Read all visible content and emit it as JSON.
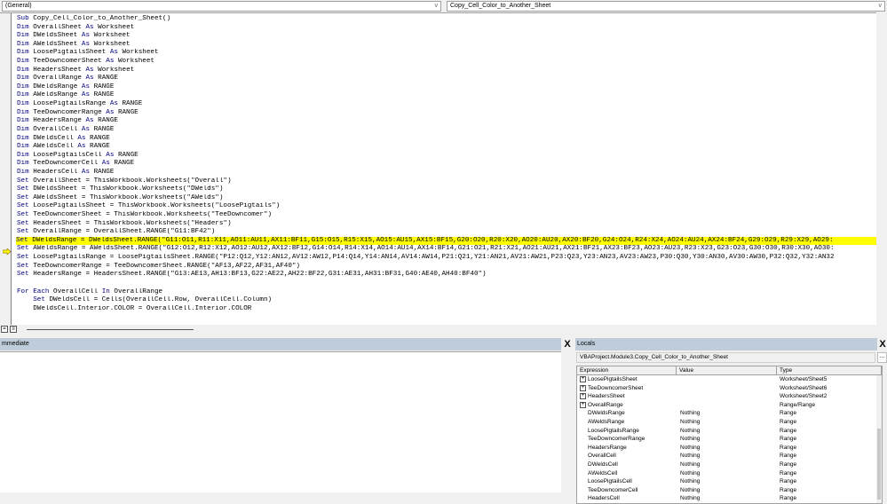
{
  "object_combo": "(General)",
  "procedure_combo": "Copy_Cell_Color_to_Another_Sheet",
  "code_lines": [
    "Sub Copy_Cell_Color_to_Another_Sheet()",
    "Dim OverallSheet As Worksheet",
    "Dim DWeldsSheet As Worksheet",
    "Dim AWeldsSheet As Worksheet",
    "Dim LoosePigtailsSheet As Worksheet",
    "Dim TeeDowncomerSheet As Worksheet",
    "Dim HeadersSheet As Worksheet",
    "Dim OverallRange As RANGE",
    "Dim DWeldsRange As RANGE",
    "Dim AWeldsRange As RANGE",
    "Dim LoosePigtailsRange As RANGE",
    "Dim TeeDowncomerRange As RANGE",
    "Dim HeadersRange As RANGE",
    "Dim OverallCell As RANGE",
    "Dim DWeldsCell As RANGE",
    "Dim AWeldsCell As RANGE",
    "Dim LoosePigtailsCell As RANGE",
    "Dim TeeDowncomerCell As RANGE",
    "Dim HeadersCell As RANGE",
    "Set OverallSheet = ThisWorkbook.Worksheets(\"Overall\")",
    "Set DWeldsSheet = ThisWorkbook.Worksheets(\"DWelds\")",
    "Set AWeldsSheet = ThisWorkbook.Worksheets(\"AWelds\")",
    "Set LoosePigtailsSheet = ThisWorkbook.Worksheets(\"LoosePigtails\")",
    "Set TeeDowncomerSheet = ThisWorkbook.Worksheets(\"TeeDowncomer\")",
    "Set HeadersSheet = ThisWorkbook.Worksheets(\"Headers\")",
    "Set OverallRange = OverallSheet.RANGE(\"G11:BF42\")",
    "Set DWeldsRange = DWeldsSheet.RANGE(\"G11:O11,R11:X11,AO11:AU11,AX11:BF11,G15:O15,R15:X15,AO15:AU15,AX15:BF15,G20:O20,R20:X20,AO20:AU20,AX20:BF20,G24:O24,R24:X24,AO24:AU24,AX24:BF24,G29:O29,R29:X29,AO29:",
    "Set AWeldsRange = AWeldsSheet.RANGE(\"G12:O12,R12:X12,AO12:AU12,AX12:BF12,G14:O14,R14:X14,AO14:AU14,AX14:BF14,G21:O21,R21:X21,AO21:AU21,AX21:BF21,AX23:BF23,AO23:AU23,R23:X23,G23:O23,G30:O30,R30:X30,AO30:",
    "Set LoosePigtailsRange = LoosePigtailsSheet.RANGE(\"P12:Q12,Y12:AN12,AV12:AW12,P14:Q14,Y14:AN14,AV14:AW14,P21:Q21,Y21:AN21,AV21:AW21,P23:Q23,Y23:AN23,AV23:AW23,P30:Q30,Y30:AN30,AV30:AW30,P32:Q32,Y32:AN32",
    "Set TeeDowncomerRange = TeeDowncomerSheet.RANGE(\"AF13,AF22,AF31,AF40\")",
    "Set HeadersRange = HeadersSheet.RANGE(\"G13:AE13,AH13:BF13,G22:AE22,AH22:BF22,G31:AE31,AH31:BF31,G40:AE40,AH40:BF40\")",
    "",
    "For Each OverallCell In OverallRange",
    "    Set DWeldsCell = Cells(OverallCell.Row, OverallCell.Column)",
    "    DWeldsCell.Interior.COLOR = OverallCell.Interior.COLOR"
  ],
  "highlight_color": "#ffff00",
  "immediate": {
    "title": "mmediate",
    "close": "X"
  },
  "locals": {
    "title": "Locals",
    "close": "X",
    "context": "VBAProject.Module3.Copy_Cell_Color_to_Another_Sheet",
    "context_button": "...",
    "headers": [
      "Expression",
      "Value",
      "Type"
    ],
    "rows": [
      {
        "expr": "LoosePigtailsSheet",
        "value": "",
        "type": "Worksheet/Sheet5",
        "expandable": true
      },
      {
        "expr": "TeeDowncomerSheet",
        "value": "",
        "type": "Worksheet/Sheet6",
        "expandable": true
      },
      {
        "expr": "HeadersSheet",
        "value": "",
        "type": "Worksheet/Sheet2",
        "expandable": true
      },
      {
        "expr": "OverallRange",
        "value": "",
        "type": "Range/Range",
        "expandable": true
      },
      {
        "expr": "DWeldsRange",
        "value": "Nothing",
        "type": "Range",
        "expandable": false
      },
      {
        "expr": "AWeldsRange",
        "value": "Nothing",
        "type": "Range",
        "expandable": false
      },
      {
        "expr": "LoosePigtailsRange",
        "value": "Nothing",
        "type": "Range",
        "expandable": false
      },
      {
        "expr": "TeeDowncomerRange",
        "value": "Nothing",
        "type": "Range",
        "expandable": false
      },
      {
        "expr": "HeadersRange",
        "value": "Nothing",
        "type": "Range",
        "expandable": false
      },
      {
        "expr": "OverallCell",
        "value": "Nothing",
        "type": "Range",
        "expandable": false
      },
      {
        "expr": "DWeldsCell",
        "value": "Nothing",
        "type": "Range",
        "expandable": false
      },
      {
        "expr": "AWeldsCell",
        "value": "Nothing",
        "type": "Range",
        "expandable": false
      },
      {
        "expr": "LoosePigtailsCell",
        "value": "Nothing",
        "type": "Range",
        "expandable": false
      },
      {
        "expr": "TeeDowncomerCell",
        "value": "Nothing",
        "type": "Range",
        "expandable": false
      },
      {
        "expr": "HeadersCell",
        "value": "Nothing",
        "type": "Range",
        "expandable": false
      }
    ]
  }
}
